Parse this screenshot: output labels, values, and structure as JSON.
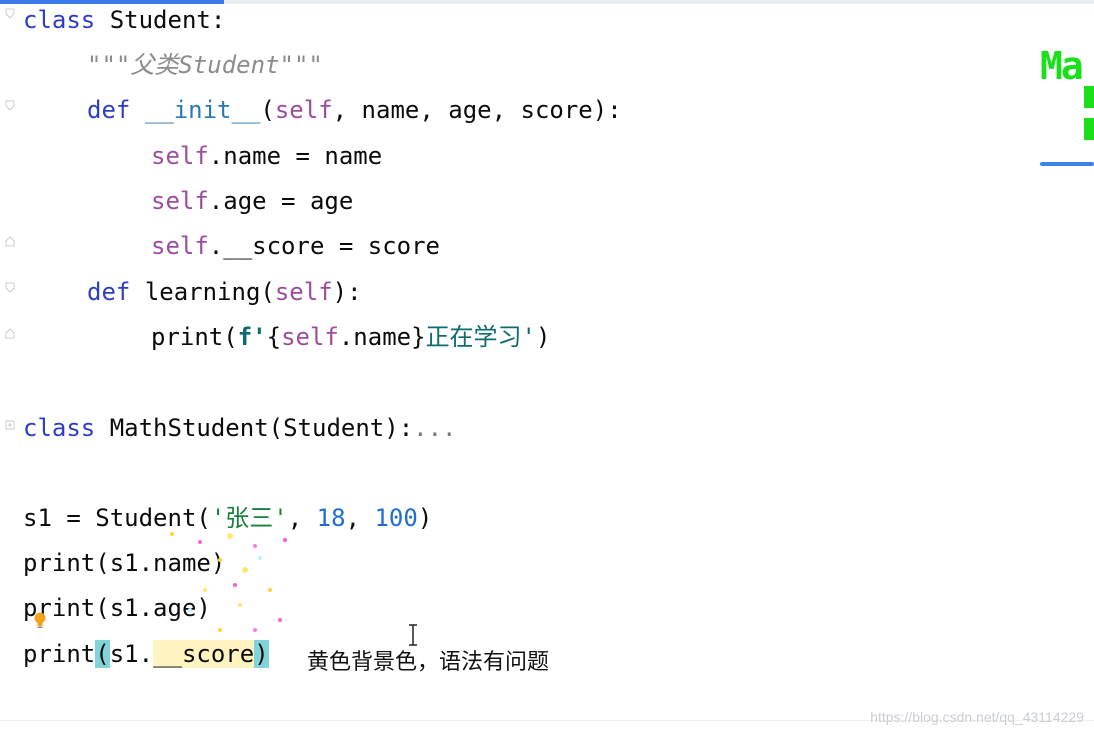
{
  "code": {
    "line1": {
      "kw": "class",
      "name": "Student:"
    },
    "line2": {
      "doc": "\"\"\"父类Student\"\"\""
    },
    "line3": {
      "kw": "def",
      "fn": "__init__",
      "open": "(",
      "self": "self",
      "rest": ", name, age, score):"
    },
    "line4": {
      "self": "self",
      "rest": ".name = name"
    },
    "line5": {
      "self": "self",
      "rest": ".age = age"
    },
    "line6": {
      "self": "self",
      "rest": ".__score = score"
    },
    "line7": {
      "kw": "def",
      "name": "learning(",
      "self": "self",
      "rest": "):"
    },
    "line8": {
      "call": "print(",
      "f": "f'",
      "brace_open": "{",
      "self": "self",
      "mid": ".name",
      "brace_close": "}",
      "text": "正在学习'",
      "close": ")"
    },
    "line9": {
      "kw": "class",
      "name": "MathStudent(Student):",
      "dots": "..."
    },
    "line10": {
      "lhs": "s1 = Student(",
      "str": "'张三'",
      "comma1": ", ",
      "n1": "18",
      "comma2": ", ",
      "n2": "100",
      "close": ")"
    },
    "line11": {
      "text": "print(s1.name)"
    },
    "line12": {
      "text": "print(s1.age)"
    },
    "line13": {
      "call": "print",
      "open": "(",
      "mid": "s1.",
      "score": "__score",
      "close": ")"
    }
  },
  "annotation": "黄色背景色，语法有问题",
  "watermark": "https://blog.csdn.net/qq_43114229",
  "side_panel": {
    "text": "Ma"
  },
  "colors": {
    "accent": "#3d7be8",
    "keyword": "#2d3ec5",
    "self": "#9b4d9e",
    "number": "#1e6cd6",
    "side_green": "#19e019"
  },
  "icons": {
    "bulb": "lightbulb-icon",
    "cursor": "text-cursor-icon",
    "fold": "fold-marker-icon"
  }
}
